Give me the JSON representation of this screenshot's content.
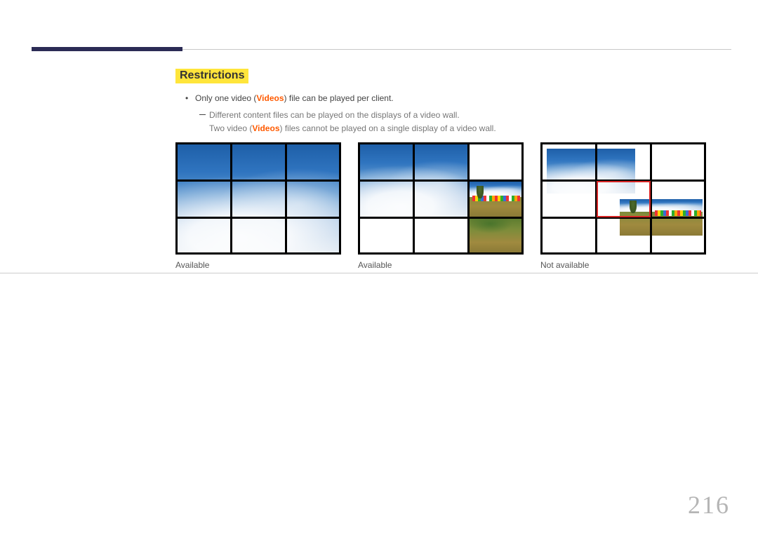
{
  "page": {
    "number": "216"
  },
  "section": {
    "title": "Restrictions"
  },
  "bullet": {
    "part1": "Only one video (",
    "accent": "Videos",
    "part2": ") file can be played per client."
  },
  "dash": {
    "line1": "Different content files can be played on the displays of a video wall.",
    "line2_part1": "Two video (",
    "line2_accent": "Videos",
    "line2_part2": ") files cannot be played on a single display of a video wall."
  },
  "captions": {
    "c1": "Available",
    "c2": "Available",
    "c3": "Not available"
  }
}
